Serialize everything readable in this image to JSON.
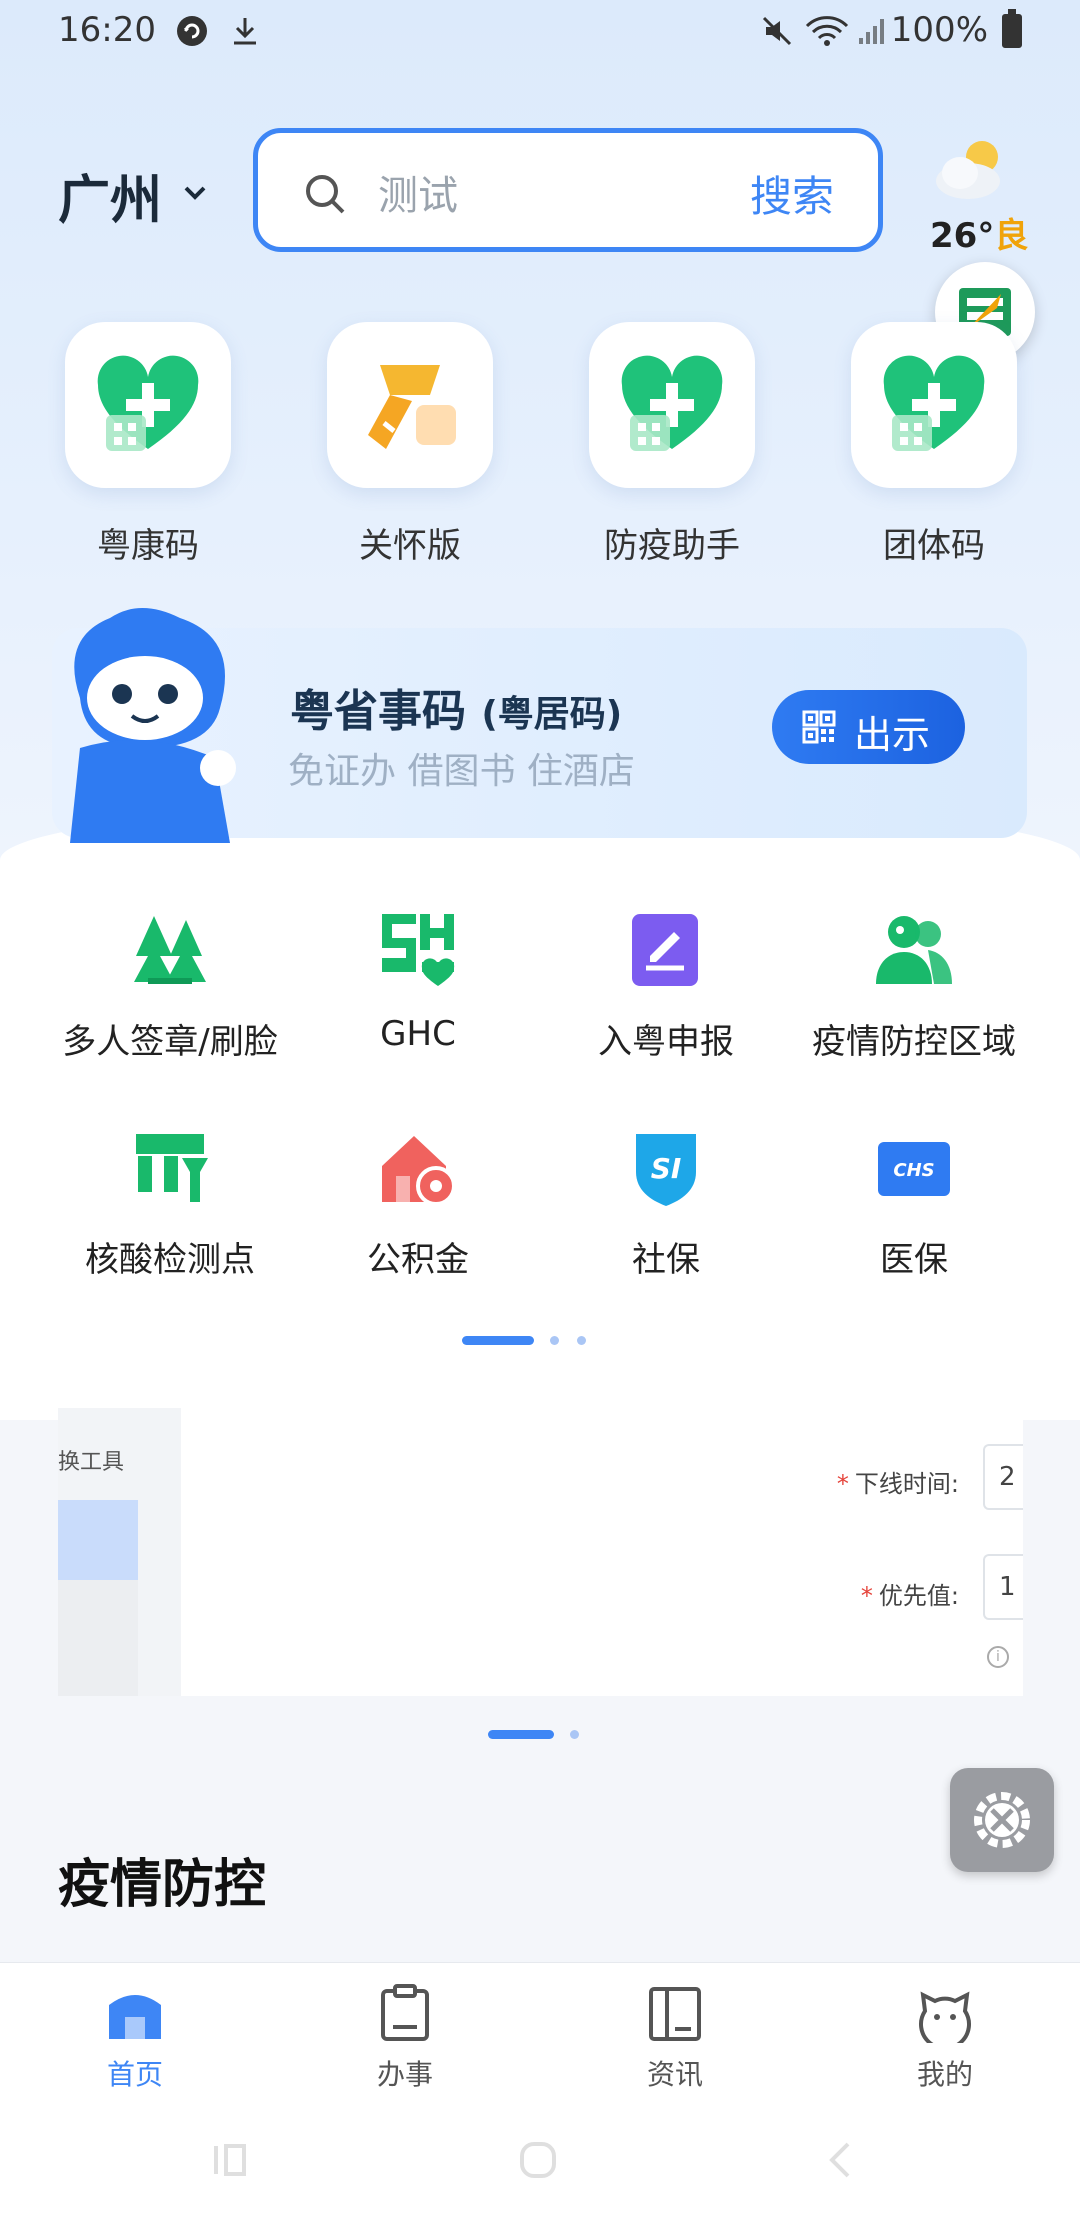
{
  "status_bar": {
    "time": "16:20",
    "battery": "100%"
  },
  "header": {
    "city": "广州",
    "search_placeholder": "测试",
    "search_button": "搜索",
    "temperature": "26°",
    "air_quality": "良"
  },
  "quick_apps": [
    {
      "label": "粤康码",
      "icon": "green-heart-health-code-icon"
    },
    {
      "label": "关怀版",
      "icon": "orange-scarf-care-icon"
    },
    {
      "label": "防疫助手",
      "icon": "green-heart-health-code-icon"
    },
    {
      "label": "团体码",
      "icon": "green-heart-health-code-icon"
    }
  ],
  "banner": {
    "title": "粤省事码",
    "title_suffix": "(粤居码)",
    "subtitle": "免证办 借图书 住酒店",
    "button": "出示"
  },
  "services": [
    {
      "label": "多人签章/刷脸",
      "icon": "tree-group-icon"
    },
    {
      "label": "GHC",
      "icon": "ghc-icon"
    },
    {
      "label": "入粤申报",
      "icon": "edit-declare-icon"
    },
    {
      "label": "疫情防控区域",
      "icon": "people-area-icon"
    },
    {
      "label": "核酸检测点",
      "icon": "test-point-icon"
    },
    {
      "label": "公积金",
      "icon": "housing-fund-icon"
    },
    {
      "label": "社保",
      "icon": "social-security-icon"
    },
    {
      "label": "医保",
      "icon": "medical-insurance-icon"
    }
  ],
  "embedded_card": {
    "left_text": "换工具",
    "field1_label": "下线时间:",
    "field1_value": "2",
    "field2_label": "优先值:",
    "field2_value": "1",
    "required_mark": "*",
    "info_mark": "i"
  },
  "section_title": "疫情防控",
  "bottom_nav": [
    {
      "label": "首页",
      "active": true
    },
    {
      "label": "办事",
      "active": false
    },
    {
      "label": "资讯",
      "active": false
    },
    {
      "label": "我的",
      "active": false
    }
  ],
  "colors": {
    "accent": "#3e86f5",
    "green": "#19b96b",
    "orange": "#f5a623"
  }
}
